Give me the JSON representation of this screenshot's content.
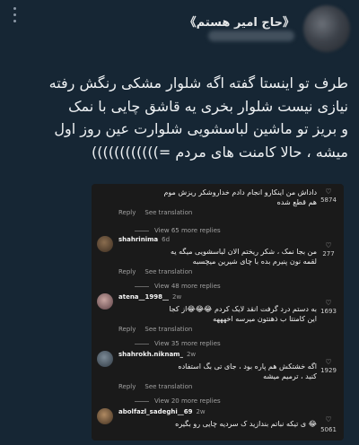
{
  "tweet": {
    "display_name": "《حاج امیر هستم》",
    "lines": [
      "طرف تو اینستا گفته اگه شلوار مشکی رنگش رفته",
      "نیازی نیست شلوار بخری یه قاشق چایی با نمک",
      "و بریز تو ماشین لباسشویی شلوارت عین روز اول",
      "میشه ، حالا کامنت های مردم =))))))))))))"
    ]
  },
  "comments": {
    "reply_label": "Reply",
    "translate_label": "See translation",
    "items": [
      {
        "username": "",
        "time": "",
        "text_lines": [
          "داداش من اینکارو انجام دادم خداروشکر ریزش موم",
          "هم قطع شده"
        ],
        "likes": "5874",
        "view_more": "View 65 more replies"
      },
      {
        "username": "shahrinima",
        "time": "6d",
        "text_lines": [
          "من بجا نمک ، شکر ریختم الان لباسشویی میگه یه",
          "لقمه نون پنیرم بده با چای شیرین میچسبه"
        ],
        "likes": "277",
        "view_more": "View 48 more replies"
      },
      {
        "username": "atena__1998__",
        "time": "2w",
        "text_lines": [
          "به دستم درد گرفت انقد لایک کردم 😂😂😂از کجا",
          "این کامنتا ب ذهنتون میرسه اخهههه"
        ],
        "likes": "1693",
        "view_more": "View 35 more replies"
      },
      {
        "username": "shahrokh.niknam_",
        "time": "2w",
        "text_lines": [
          "اگه خشتکش هم پاره بود ، جای تی بگ استفاده",
          "کنید ، ترمیم میشه"
        ],
        "likes": "1929",
        "view_more": "View 20 more replies"
      },
      {
        "username": "abolfazl_sadeghi__69",
        "time": "2w",
        "text_lines": [
          "😂 ی تیکه نباتم بندازید ک سردیه چایی رو بگیره"
        ],
        "likes": "5061",
        "view_more": ""
      }
    ]
  },
  "colors": {
    "background": "#162634",
    "card": "#1a1a1a",
    "text": "#e7e9ea"
  }
}
